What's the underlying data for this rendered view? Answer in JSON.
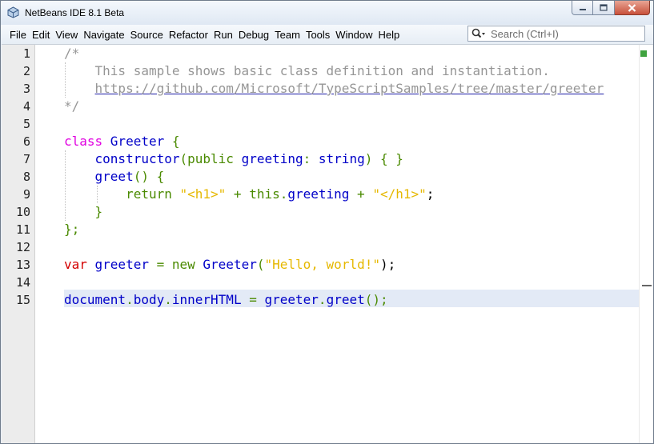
{
  "window": {
    "title": "NetBeans IDE 8.1 Beta",
    "controls": {
      "minimize": "minimize-icon",
      "maximize": "maximize-icon",
      "close": "close-icon"
    }
  },
  "menubar": {
    "items": [
      "File",
      "Edit",
      "View",
      "Navigate",
      "Source",
      "Refactor",
      "Run",
      "Debug",
      "Team",
      "Tools",
      "Window",
      "Help"
    ],
    "search": {
      "placeholder": "Search (Ctrl+I)",
      "icon": "search-icon"
    }
  },
  "editor": {
    "line_numbers": [
      "1",
      "2",
      "3",
      "4",
      "5",
      "6",
      "7",
      "8",
      "9",
      "10",
      "11",
      "12",
      "13",
      "14",
      "15"
    ],
    "current_line": 15,
    "lines": [
      [
        {
          "t": "/*",
          "c": "c-comment"
        }
      ],
      [
        {
          "t": "    This sample shows basic class definition and instantiation.",
          "c": "c-comment"
        }
      ],
      [
        {
          "t": "    ",
          "c": "c-comment"
        },
        {
          "t": "https://github.com/Microsoft/TypeScriptSamples/tree/master/greeter",
          "c": "c-link"
        }
      ],
      [
        {
          "t": "*/",
          "c": "c-comment"
        }
      ],
      [],
      [
        {
          "t": "class ",
          "c": "c-kw"
        },
        {
          "t": "Greeter",
          "c": "c-id"
        },
        {
          "t": " {",
          "c": "c-green"
        }
      ],
      [
        {
          "t": "    ",
          "c": "c-black"
        },
        {
          "t": "constructor",
          "c": "c-id"
        },
        {
          "t": "(",
          "c": "c-green"
        },
        {
          "t": "public ",
          "c": "c-green"
        },
        {
          "t": "greeting",
          "c": "c-id"
        },
        {
          "t": ": ",
          "c": "c-green"
        },
        {
          "t": "string",
          "c": "c-id"
        },
        {
          "t": ") { }",
          "c": "c-green"
        }
      ],
      [
        {
          "t": "    ",
          "c": "c-black"
        },
        {
          "t": "greet",
          "c": "c-id"
        },
        {
          "t": "() {",
          "c": "c-green"
        }
      ],
      [
        {
          "t": "        return ",
          "c": "c-green"
        },
        {
          "t": "\"<h1>\"",
          "c": "c-str"
        },
        {
          "t": " + this.",
          "c": "c-green"
        },
        {
          "t": "greeting",
          "c": "c-id"
        },
        {
          "t": " + ",
          "c": "c-green"
        },
        {
          "t": "\"</h1>\"",
          "c": "c-str"
        },
        {
          "t": ";",
          "c": "c-black"
        }
      ],
      [
        {
          "t": "    }",
          "c": "c-green"
        }
      ],
      [
        {
          "t": "};",
          "c": "c-green"
        }
      ],
      [],
      [
        {
          "t": "var ",
          "c": "c-kw2"
        },
        {
          "t": "greeter",
          "c": "c-id"
        },
        {
          "t": " = new ",
          "c": "c-green"
        },
        {
          "t": "Greeter",
          "c": "c-id"
        },
        {
          "t": "(",
          "c": "c-green"
        },
        {
          "t": "\"Hello, world!\"",
          "c": "c-str"
        },
        {
          "t": ");",
          "c": "c-black"
        }
      ],
      [],
      [
        {
          "t": "document",
          "c": "c-id"
        },
        {
          "t": ".",
          "c": "c-green"
        },
        {
          "t": "body",
          "c": "c-id"
        },
        {
          "t": ".",
          "c": "c-green"
        },
        {
          "t": "innerHTML",
          "c": "c-id"
        },
        {
          "t": " = ",
          "c": "c-green"
        },
        {
          "t": "greeter",
          "c": "c-id"
        },
        {
          "t": ".",
          "c": "c-green"
        },
        {
          "t": "greet",
          "c": "c-id"
        },
        {
          "t": "();",
          "c": "c-green"
        }
      ]
    ]
  }
}
